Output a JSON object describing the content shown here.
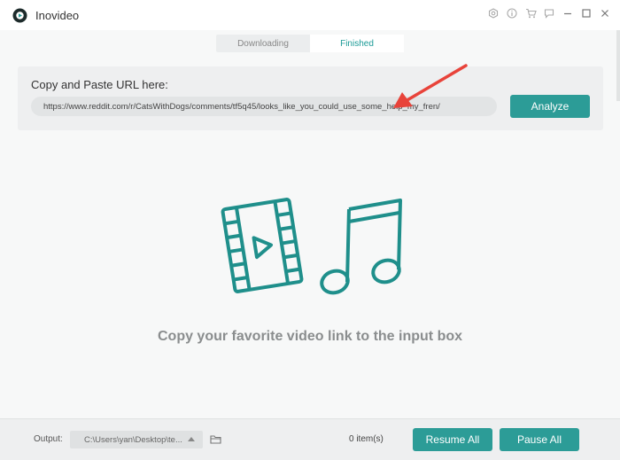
{
  "app": {
    "title": "Inovideo",
    "accent": "#2c9c97"
  },
  "tabs": [
    {
      "label": "Downloading",
      "active": false
    },
    {
      "label": "Finished",
      "active": true
    }
  ],
  "url_section": {
    "label": "Copy and Paste URL here:",
    "url_value": "https://www.reddit.com/r/CatsWithDogs/comments/tf5q45/looks_like_you_could_use_some_help_my_fren/",
    "analyze_label": "Analyze"
  },
  "empty_state": {
    "message": "Copy your favorite video link to the input box"
  },
  "footer": {
    "output_label": "Output:",
    "output_path": "C:\\Users\\yan\\Desktop\\te...",
    "items_count": "0 item(s)",
    "resume_label": "Resume All",
    "pause_label": "Pause All"
  },
  "window_icons": [
    "settings-icon",
    "info-icon",
    "cart-icon",
    "feedback-icon",
    "minimize-icon",
    "maximize-icon",
    "close-icon"
  ]
}
